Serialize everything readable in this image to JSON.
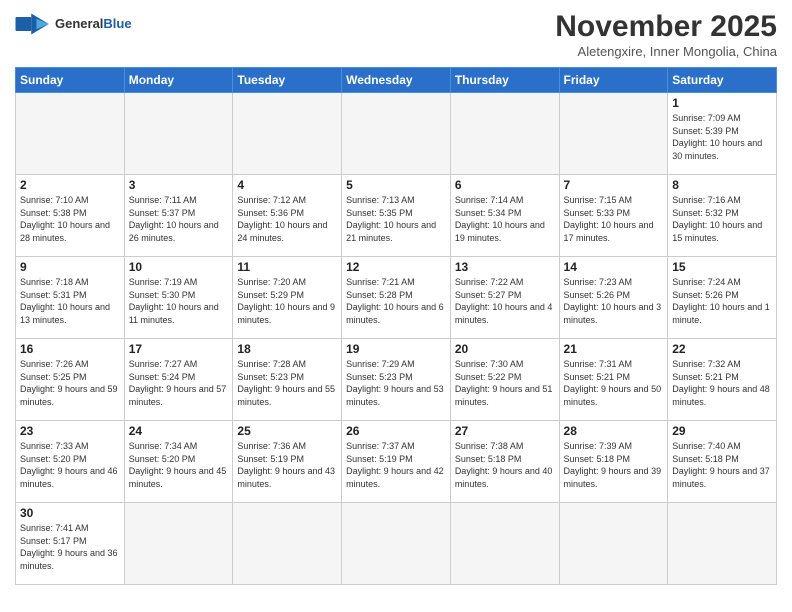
{
  "logo": {
    "text_general": "General",
    "text_blue": "Blue"
  },
  "title": "November 2025",
  "subtitle": "Aletengxire, Inner Mongolia, China",
  "days_header": [
    "Sunday",
    "Monday",
    "Tuesday",
    "Wednesday",
    "Thursday",
    "Friday",
    "Saturday"
  ],
  "weeks": [
    [
      {
        "day": "",
        "info": ""
      },
      {
        "day": "",
        "info": ""
      },
      {
        "day": "",
        "info": ""
      },
      {
        "day": "",
        "info": ""
      },
      {
        "day": "",
        "info": ""
      },
      {
        "day": "",
        "info": ""
      },
      {
        "day": "1",
        "info": "Sunrise: 7:09 AM\nSunset: 5:39 PM\nDaylight: 10 hours\nand 30 minutes."
      }
    ],
    [
      {
        "day": "2",
        "info": "Sunrise: 7:10 AM\nSunset: 5:38 PM\nDaylight: 10 hours\nand 28 minutes."
      },
      {
        "day": "3",
        "info": "Sunrise: 7:11 AM\nSunset: 5:37 PM\nDaylight: 10 hours\nand 26 minutes."
      },
      {
        "day": "4",
        "info": "Sunrise: 7:12 AM\nSunset: 5:36 PM\nDaylight: 10 hours\nand 24 minutes."
      },
      {
        "day": "5",
        "info": "Sunrise: 7:13 AM\nSunset: 5:35 PM\nDaylight: 10 hours\nand 21 minutes."
      },
      {
        "day": "6",
        "info": "Sunrise: 7:14 AM\nSunset: 5:34 PM\nDaylight: 10 hours\nand 19 minutes."
      },
      {
        "day": "7",
        "info": "Sunrise: 7:15 AM\nSunset: 5:33 PM\nDaylight: 10 hours\nand 17 minutes."
      },
      {
        "day": "8",
        "info": "Sunrise: 7:16 AM\nSunset: 5:32 PM\nDaylight: 10 hours\nand 15 minutes."
      }
    ],
    [
      {
        "day": "9",
        "info": "Sunrise: 7:18 AM\nSunset: 5:31 PM\nDaylight: 10 hours\nand 13 minutes."
      },
      {
        "day": "10",
        "info": "Sunrise: 7:19 AM\nSunset: 5:30 PM\nDaylight: 10 hours\nand 11 minutes."
      },
      {
        "day": "11",
        "info": "Sunrise: 7:20 AM\nSunset: 5:29 PM\nDaylight: 10 hours\nand 9 minutes."
      },
      {
        "day": "12",
        "info": "Sunrise: 7:21 AM\nSunset: 5:28 PM\nDaylight: 10 hours\nand 6 minutes."
      },
      {
        "day": "13",
        "info": "Sunrise: 7:22 AM\nSunset: 5:27 PM\nDaylight: 10 hours\nand 4 minutes."
      },
      {
        "day": "14",
        "info": "Sunrise: 7:23 AM\nSunset: 5:26 PM\nDaylight: 10 hours\nand 3 minutes."
      },
      {
        "day": "15",
        "info": "Sunrise: 7:24 AM\nSunset: 5:26 PM\nDaylight: 10 hours\nand 1 minute."
      }
    ],
    [
      {
        "day": "16",
        "info": "Sunrise: 7:26 AM\nSunset: 5:25 PM\nDaylight: 9 hours\nand 59 minutes."
      },
      {
        "day": "17",
        "info": "Sunrise: 7:27 AM\nSunset: 5:24 PM\nDaylight: 9 hours\nand 57 minutes."
      },
      {
        "day": "18",
        "info": "Sunrise: 7:28 AM\nSunset: 5:23 PM\nDaylight: 9 hours\nand 55 minutes."
      },
      {
        "day": "19",
        "info": "Sunrise: 7:29 AM\nSunset: 5:23 PM\nDaylight: 9 hours\nand 53 minutes."
      },
      {
        "day": "20",
        "info": "Sunrise: 7:30 AM\nSunset: 5:22 PM\nDaylight: 9 hours\nand 51 minutes."
      },
      {
        "day": "21",
        "info": "Sunrise: 7:31 AM\nSunset: 5:21 PM\nDaylight: 9 hours\nand 50 minutes."
      },
      {
        "day": "22",
        "info": "Sunrise: 7:32 AM\nSunset: 5:21 PM\nDaylight: 9 hours\nand 48 minutes."
      }
    ],
    [
      {
        "day": "23",
        "info": "Sunrise: 7:33 AM\nSunset: 5:20 PM\nDaylight: 9 hours\nand 46 minutes."
      },
      {
        "day": "24",
        "info": "Sunrise: 7:34 AM\nSunset: 5:20 PM\nDaylight: 9 hours\nand 45 minutes."
      },
      {
        "day": "25",
        "info": "Sunrise: 7:36 AM\nSunset: 5:19 PM\nDaylight: 9 hours\nand 43 minutes."
      },
      {
        "day": "26",
        "info": "Sunrise: 7:37 AM\nSunset: 5:19 PM\nDaylight: 9 hours\nand 42 minutes."
      },
      {
        "day": "27",
        "info": "Sunrise: 7:38 AM\nSunset: 5:18 PM\nDaylight: 9 hours\nand 40 minutes."
      },
      {
        "day": "28",
        "info": "Sunrise: 7:39 AM\nSunset: 5:18 PM\nDaylight: 9 hours\nand 39 minutes."
      },
      {
        "day": "29",
        "info": "Sunrise: 7:40 AM\nSunset: 5:18 PM\nDaylight: 9 hours\nand 37 minutes."
      }
    ],
    [
      {
        "day": "30",
        "info": "Sunrise: 7:41 AM\nSunset: 5:17 PM\nDaylight: 9 hours\nand 36 minutes."
      },
      {
        "day": "",
        "info": ""
      },
      {
        "day": "",
        "info": ""
      },
      {
        "day": "",
        "info": ""
      },
      {
        "day": "",
        "info": ""
      },
      {
        "day": "",
        "info": ""
      },
      {
        "day": "",
        "info": ""
      }
    ]
  ]
}
